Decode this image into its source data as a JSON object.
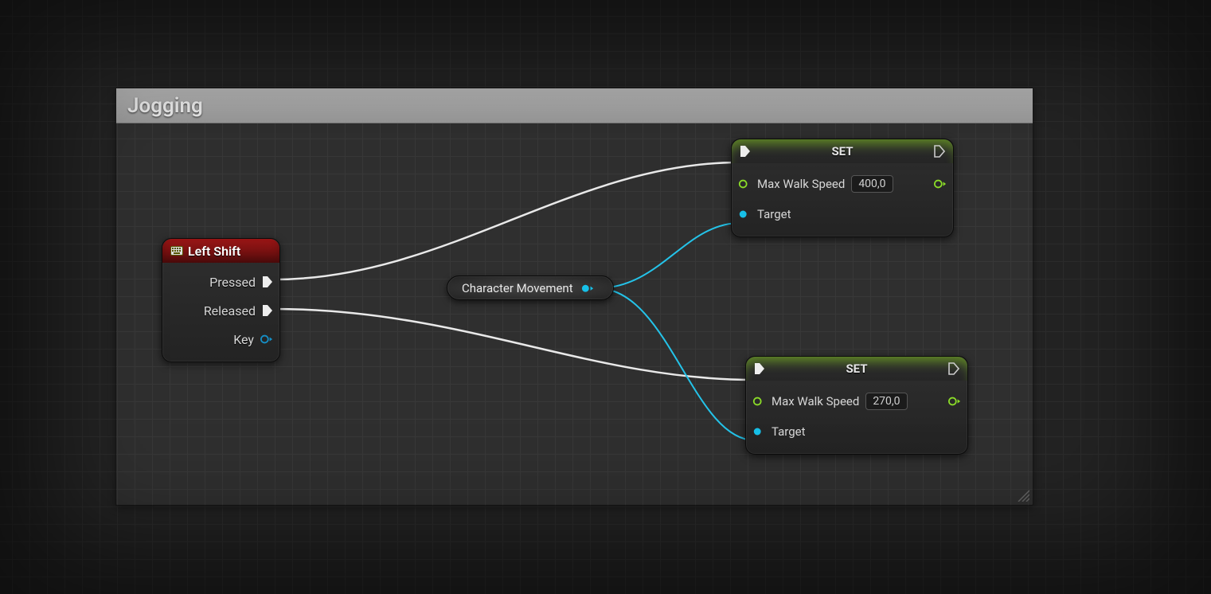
{
  "comment": {
    "title": "Jogging"
  },
  "event_node": {
    "title": "Left Shift",
    "pins": {
      "pressed": "Pressed",
      "released": "Released",
      "key": "Key"
    }
  },
  "var_node": {
    "label": "Character Movement"
  },
  "set_nodes": {
    "title": "SET",
    "param_label": "Max Walk Speed",
    "target_label": "Target",
    "pressed_value": "400,0",
    "released_value": "270,0"
  },
  "colors": {
    "exec_wire": "#e8e8e8",
    "object_wire": "#17c0e8",
    "float_pin": "#8bdc28"
  }
}
